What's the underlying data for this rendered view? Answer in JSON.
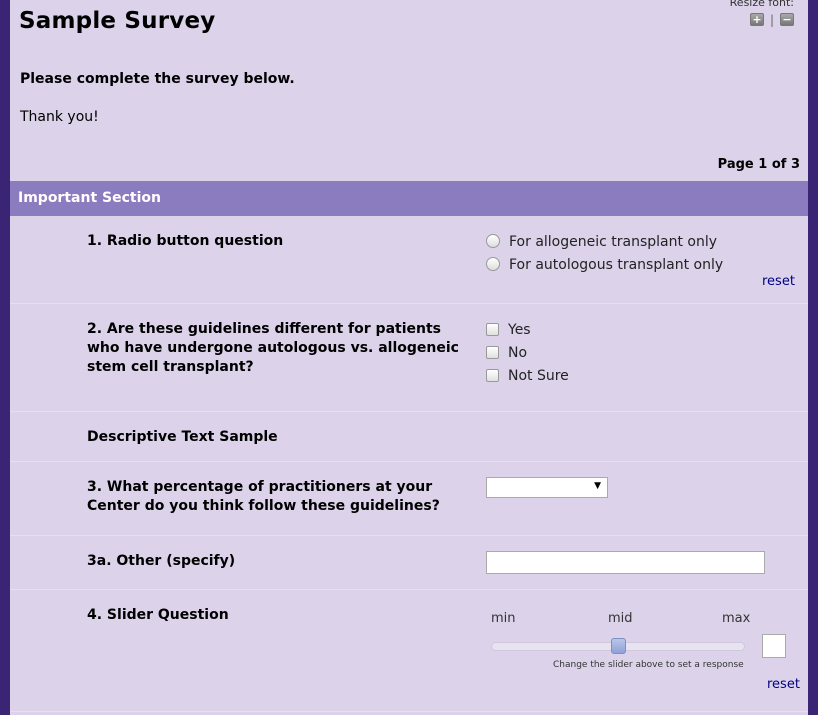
{
  "header": {
    "title": "Sample Survey",
    "resize_font_label": "Resize font:",
    "increase_glyph": "+",
    "decrease_glyph": "−",
    "separator": "|",
    "instructions": "Please complete the survey below.",
    "thank_you": "Thank you!",
    "page_indicator": "Page 1 of 3"
  },
  "section": {
    "title": "Important Section"
  },
  "questions": {
    "q1": {
      "label": "1. Radio button question",
      "options": [
        "For allogeneic transplant only",
        "For autologous transplant only"
      ],
      "reset": "reset"
    },
    "q2": {
      "label": "2. Are these guidelines different for patients who have undergone autologous vs. allogeneic stem cell transplant?",
      "options": [
        "Yes",
        "No",
        "Not Sure"
      ]
    },
    "descriptive": "Descriptive Text Sample",
    "q3": {
      "label": "3. What percentage of practitioners at your Center do you think follow these guidelines?",
      "selected": "",
      "arrow": "▼"
    },
    "q3a": {
      "label": "3a. Other (specify)",
      "value": ""
    },
    "q4": {
      "label": "4. Slider Question",
      "min_label": "min",
      "mid_label": "mid",
      "max_label": "max",
      "position_fraction": 0.5,
      "help_text": "Change the slider above to set a response",
      "value": "",
      "reset": "reset"
    }
  },
  "colors": {
    "outer_background": "#3a2574",
    "page_background": "#dcd3ea",
    "section_header": "#8b7cc0",
    "link": "#000080"
  }
}
